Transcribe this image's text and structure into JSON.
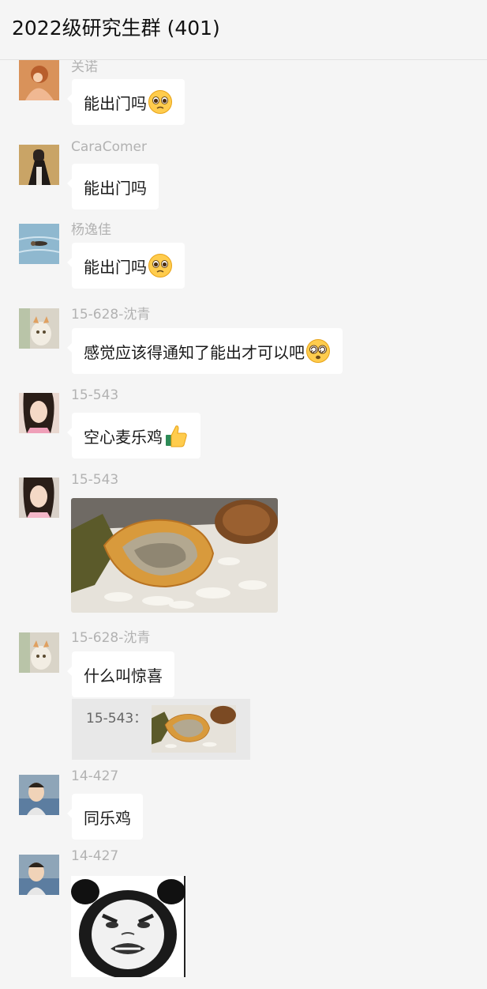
{
  "header": {
    "title": "2022级研究生群 (401)"
  },
  "messages": [
    {
      "sender": "关诺",
      "text": "能出门吗",
      "emoji": "pleading-face-icon"
    },
    {
      "sender": "CaraComer",
      "text": "能出门吗"
    },
    {
      "sender": "杨逸佳",
      "text": "能出门吗",
      "emoji": "pleading-face-icon"
    },
    {
      "sender": "15-628-沈青",
      "text": "感觉应该得通知了能出才可以吧",
      "emoji": "dizzy-face-icon"
    },
    {
      "sender": "15-543",
      "text": "空心麦乐鸡",
      "emoji": "thumbs-up-icon"
    },
    {
      "sender": "15-543",
      "image": "fried-nugget-photo"
    },
    {
      "sender": "15-628-沈青",
      "text": "什么叫惊喜",
      "quote": {
        "label": "15-543：",
        "image": "fried-nugget-photo"
      }
    },
    {
      "sender": "14-427",
      "text": "同乐鸡"
    },
    {
      "sender": "14-427",
      "image": "panda-meme-sticker"
    }
  ]
}
